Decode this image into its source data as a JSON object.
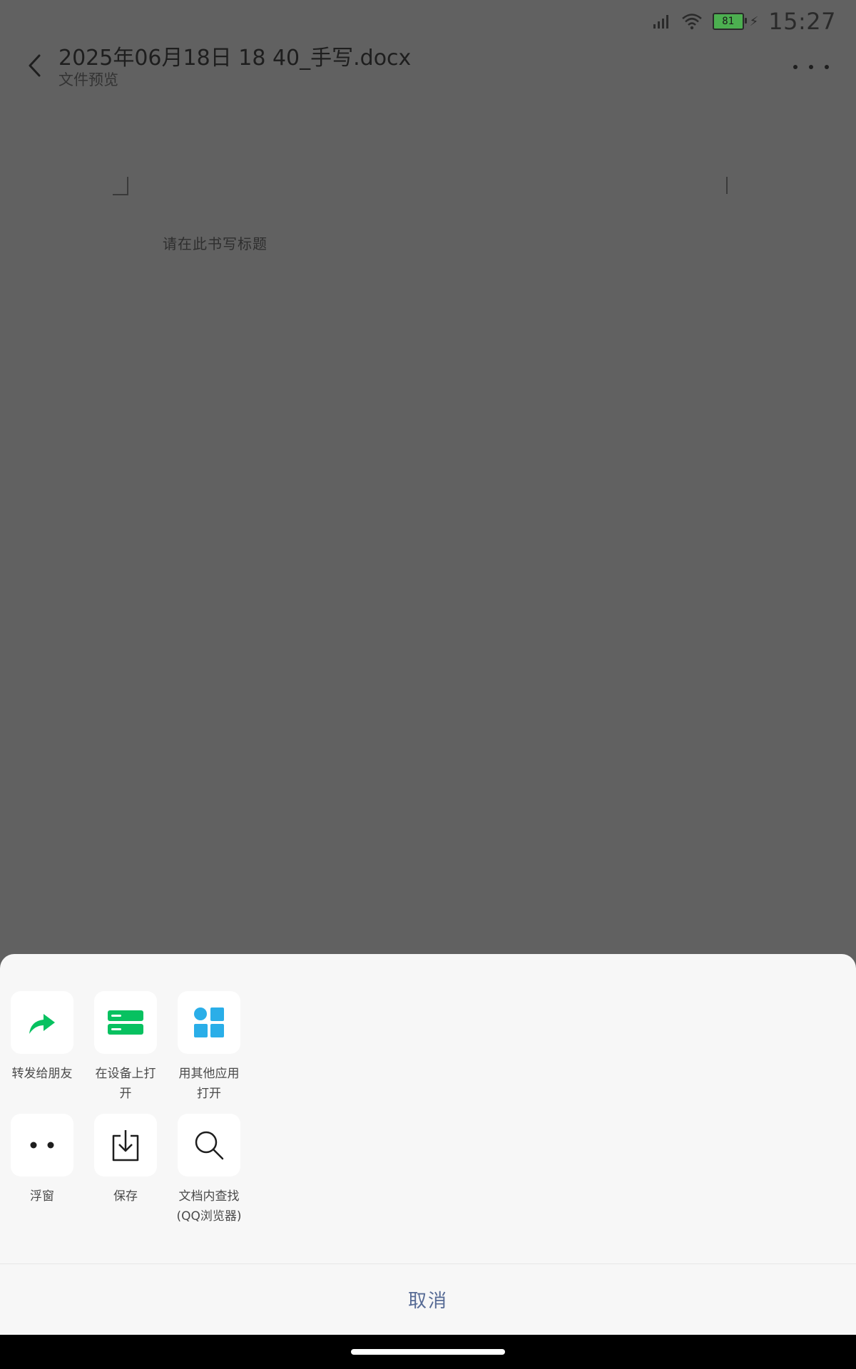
{
  "status_bar": {
    "time": "15:27",
    "battery_level": "81"
  },
  "header": {
    "title": "2025年06月18日 18 40_手写.docx",
    "subtitle": "文件预览"
  },
  "document": {
    "placeholder": "请在此书写标题"
  },
  "sheet": {
    "actions": [
      {
        "label": "转发给朋友",
        "icon": "share-forward-icon",
        "color": "#07c160"
      },
      {
        "label": "在设备上打开",
        "icon": "device-open-icon",
        "color": "#07c160"
      },
      {
        "label": "用其他应用打开",
        "icon": "other-apps-icon",
        "color": "#2aaee8"
      },
      {
        "label": "浮窗",
        "icon": "floating-window-icon",
        "color": "#1e1e1e"
      },
      {
        "label": "保存",
        "icon": "save-download-icon",
        "color": "#1e1e1e"
      },
      {
        "label": "文档内查找(QQ浏览器)",
        "icon": "search-icon",
        "color": "#1e1e1e"
      }
    ],
    "cancel_label": "取消"
  },
  "colors": {
    "accent_green": "#07c160",
    "accent_blue": "#2aaee8",
    "cancel_text": "#576b95"
  }
}
